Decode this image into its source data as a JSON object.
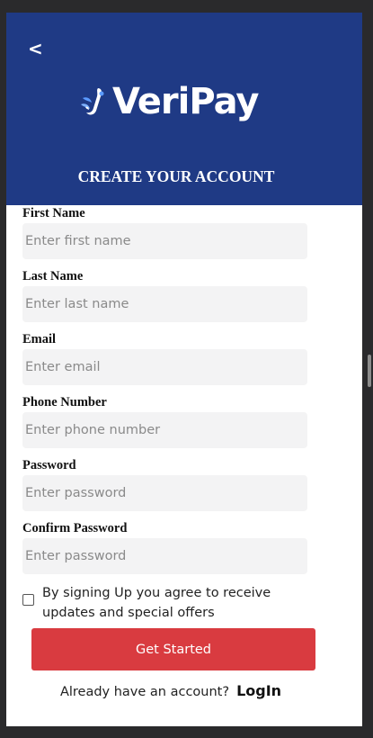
{
  "header": {
    "back_label": "<",
    "logo_text": "VeriPay",
    "title": "CREATE YOUR ACCOUNT"
  },
  "form": {
    "fields": [
      {
        "label": "First Name",
        "placeholder": "Enter first name",
        "value": ""
      },
      {
        "label": "Last Name",
        "placeholder": "Enter last name",
        "value": ""
      },
      {
        "label": "Email",
        "placeholder": "Enter email",
        "value": ""
      },
      {
        "label": "Phone Number",
        "placeholder": "Enter phone number",
        "value": ""
      },
      {
        "label": "Password",
        "placeholder": "Enter password",
        "value": ""
      },
      {
        "label": "Confirm Password",
        "placeholder": "Enter password",
        "value": ""
      }
    ],
    "agree_text": "By signing Up you agree to receive updates and special offers",
    "agree_checked": false,
    "submit_label": "Get Started"
  },
  "footer": {
    "login_prompt": "Already have an account?",
    "login_link": "LogIn"
  },
  "colors": {
    "header_bg": "#1f3a85",
    "button_bg": "#d93b40",
    "input_bg": "#f3f3f4",
    "logo_accent": "#5b9bff"
  }
}
